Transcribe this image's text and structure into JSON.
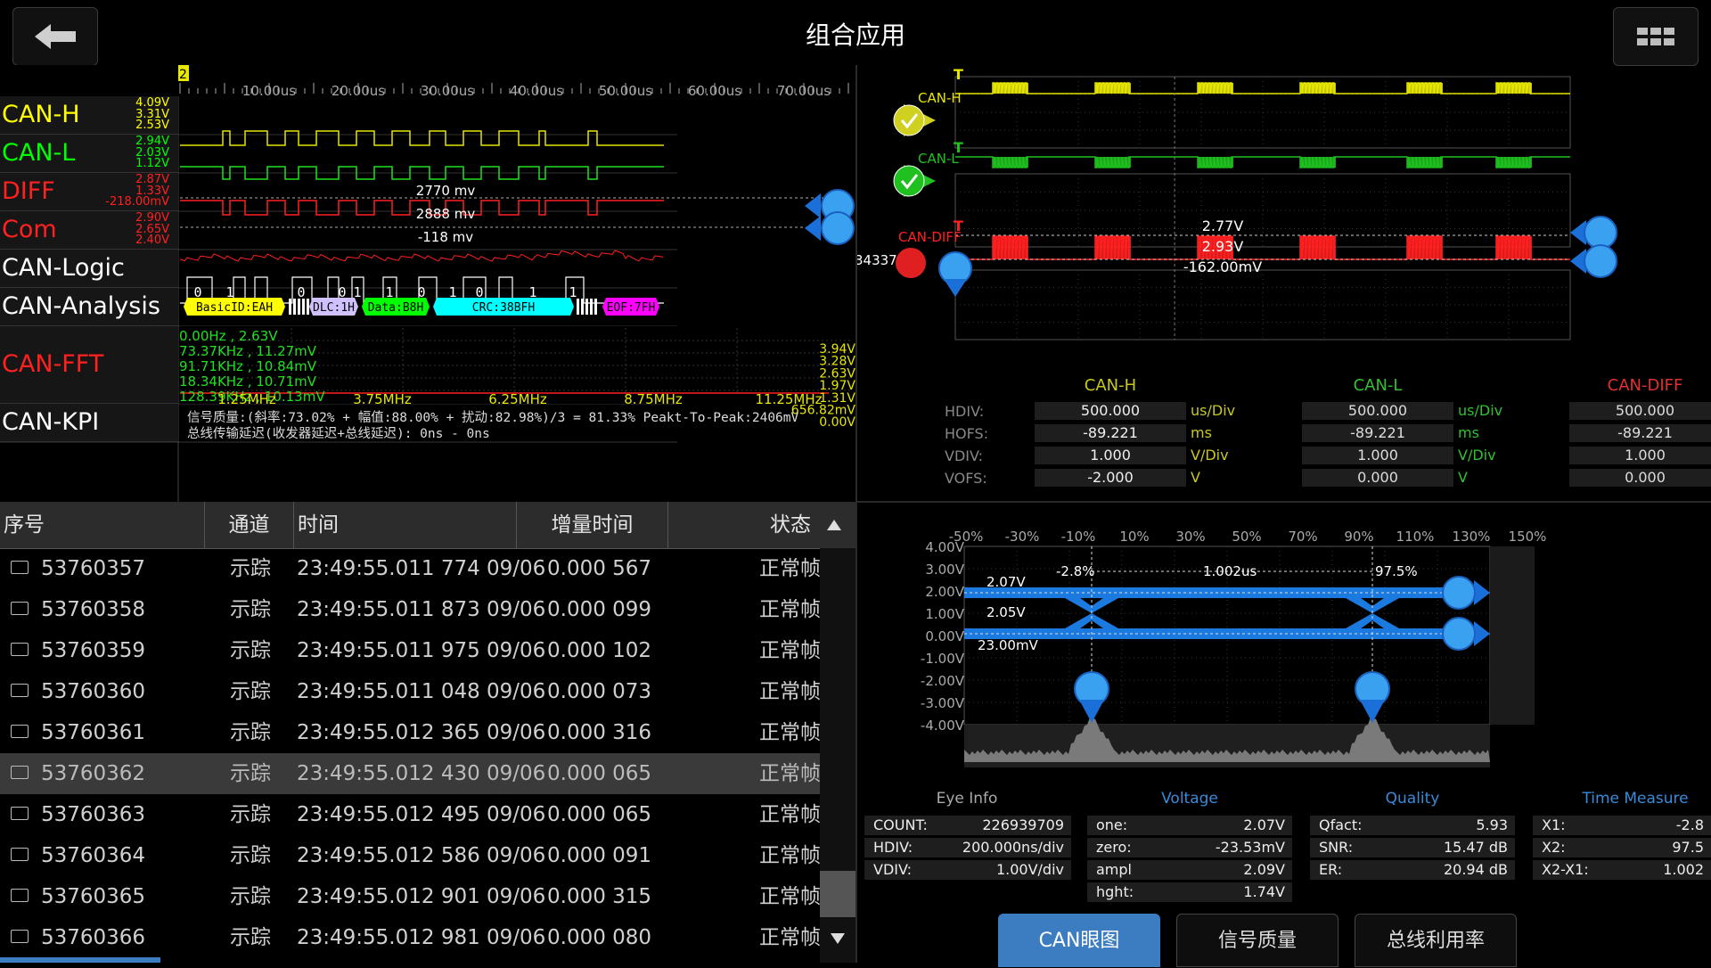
{
  "header": {
    "title": "组合应用"
  },
  "left": {
    "marker": "2",
    "time_ticks": [
      "10.00us",
      "20.00us",
      "30.00us",
      "40.00us",
      "50.00us",
      "60.00us",
      "70.00us"
    ],
    "channels": [
      {
        "name": "CAN-H",
        "color": "#ffff00",
        "scale": [
          "4.09V",
          "3.31V",
          "2.53V"
        ]
      },
      {
        "name": "CAN-L",
        "color": "#00ff00",
        "scale": [
          "2.94V",
          "2.03V",
          "1.12V"
        ]
      },
      {
        "name": "DIFF",
        "color": "#ff2020",
        "scale": [
          "2.87V",
          "1.33V",
          "-218.00mV"
        ]
      },
      {
        "name": "Com",
        "color": "#ff2020",
        "scale": [
          "2.90V",
          "2.65V",
          "2.40V"
        ]
      },
      {
        "name": "CAN-Logic",
        "color": "#ffffff",
        "scale": []
      },
      {
        "name": "CAN-Analysis",
        "color": "#ffffff",
        "scale": []
      },
      {
        "name": "CAN-FFT",
        "color": "#ff2020",
        "scale": []
      },
      {
        "name": "CAN-KPI",
        "color": "#ffffff",
        "scale": []
      }
    ],
    "diff_measure": [
      "2770 mv",
      "2888 mv",
      "-118 mv"
    ],
    "logic_bits": [
      "0",
      "1",
      "0",
      "0",
      "1",
      "1",
      "0",
      "1",
      "0",
      "1",
      "1"
    ],
    "analysis_segments": [
      {
        "label": "BasicID:EAH",
        "color": "#ffff00"
      },
      {
        "label": "DLC:1H",
        "color": "#d0c0ff"
      },
      {
        "label": "Data:B8H",
        "color": "#00ff00"
      },
      {
        "label": "CRC:38BFH",
        "color": "#00ffff"
      },
      {
        "label": "EOF:7FH",
        "color": "#ff00ff"
      }
    ],
    "fft_peaks": [
      "0.00Hz , 2.63V",
      "73.37KHz , 11.27mV",
      "91.71KHz , 10.84mV",
      "18.34KHz , 10.71mV",
      "128.39KHz , 10.13mV"
    ],
    "fft_scale": [
      "3.94V",
      "3.28V",
      "2.63V",
      "1.97V",
      "1.31V",
      "656.82mV",
      "0.00V"
    ],
    "fft_freqs": [
      "1.25MHz",
      "3.75MHz",
      "6.25MHz",
      "8.75MHz",
      "11.25MHz"
    ],
    "kpi_line1": "信号质量:(斜率:73.02% + 幅值:88.00% + 扰动:82.98%)/3 = 81.33%  Peakt-To-Peak:2406mV",
    "kpi_line2": "总线传输延迟(收发器延迟+总线延迟): 0ns - 0ns"
  },
  "table": {
    "headers": [
      "序号",
      "通道",
      "时间",
      "增量时间",
      "状态"
    ],
    "rows": [
      [
        "53760357",
        "示踪",
        "23:49:55.011 774 09/06",
        "0.000 567",
        "正常帧"
      ],
      [
        "53760358",
        "示踪",
        "23:49:55.011 873 09/06",
        "0.000 099",
        "正常帧"
      ],
      [
        "53760359",
        "示踪",
        "23:49:55.011 975 09/06",
        "0.000 102",
        "正常帧"
      ],
      [
        "53760360",
        "示踪",
        "23:49:55.011 048 09/06",
        "0.000 073",
        "正常帧"
      ],
      [
        "53760361",
        "示踪",
        "23:49:55.012 365 09/06",
        "0.000 316",
        "正常帧"
      ],
      [
        "53760362",
        "示踪",
        "23:49:55.012 430 09/06",
        "0.000 065",
        "正常帧"
      ],
      [
        "53760363",
        "示踪",
        "23:49:55.012 495 09/06",
        "0.000 065",
        "正常帧"
      ],
      [
        "53760364",
        "示踪",
        "23:49:55.012 586 09/06",
        "0.000 091",
        "正常帧"
      ],
      [
        "53760365",
        "示踪",
        "23:49:55.012 901 09/06",
        "0.000 315",
        "正常帧"
      ],
      [
        "53760366",
        "示踪",
        "23:49:55.012 981 09/06",
        "0.000 080",
        "正常帧"
      ]
    ],
    "selected_row": 5
  },
  "scope": {
    "labels": [
      "CAN-H",
      "CAN-L",
      "CAN-DIFF"
    ],
    "diff_measure": [
      "2.77V",
      "2.93V",
      "-162.00mV"
    ],
    "cursor_value": "34337326",
    "info": {
      "rows": [
        "HDIV:",
        "HOFS:",
        "VDIV:",
        "VOFS:"
      ],
      "cols": [
        {
          "name": "CAN-H",
          "color": "#c8c820",
          "vals": [
            "500.000",
            "-89.221",
            "1.000",
            "-2.000"
          ],
          "units": [
            "us/Div",
            "ms",
            "V/Div",
            "V"
          ]
        },
        {
          "name": "CAN-L",
          "color": "#30c030",
          "vals": [
            "500.000",
            "-89.221",
            "1.000",
            "0.000"
          ],
          "units": [
            "us/Div",
            "ms",
            "V/Div",
            "V"
          ]
        },
        {
          "name": "CAN-DIFF",
          "color": "#e03030",
          "vals": [
            "500.000",
            "-89.221",
            "1.000",
            "0.000"
          ],
          "units": []
        }
      ]
    }
  },
  "eye": {
    "x_ticks": [
      "-50%",
      "-30%",
      "-10%",
      "10%",
      "30%",
      "50%",
      "70%",
      "90%",
      "110%",
      "130%",
      "150%"
    ],
    "y_ticks": [
      "4.00V",
      "3.00V",
      "2.00V",
      "1.00V",
      "0.00V",
      "-1.00V",
      "-2.00V",
      "-3.00V",
      "-4.00V"
    ],
    "annot": [
      "2.07V",
      "2.05V",
      "23.00mV",
      "-2.8%",
      "1.002us",
      "97.5%"
    ],
    "sections": [
      "Eye Info",
      "Voltage",
      "Quality",
      "Time Measure"
    ],
    "eye_info": [
      [
        "COUNT:",
        "226939709"
      ],
      [
        "HDIV:",
        "200.000ns/div"
      ],
      [
        "VDIV:",
        "1.00V/div"
      ]
    ],
    "voltage": [
      [
        "one:",
        "2.07V"
      ],
      [
        "zero:",
        "-23.53mV"
      ],
      [
        "ampl",
        "2.09V"
      ],
      [
        "hght:",
        "1.74V"
      ]
    ],
    "quality": [
      [
        "Qfact:",
        "5.93"
      ],
      [
        "SNR:",
        "15.47 dB"
      ],
      [
        "ER:",
        "20.94 dB"
      ]
    ],
    "time": [
      [
        "X1:",
        "-2.8"
      ],
      [
        "X2:",
        "97.5"
      ],
      [
        "X2-X1:",
        "1.002"
      ]
    ]
  },
  "tabs": [
    "CAN眼图",
    "信号质量",
    "总线利用率"
  ],
  "active_tab": 0
}
